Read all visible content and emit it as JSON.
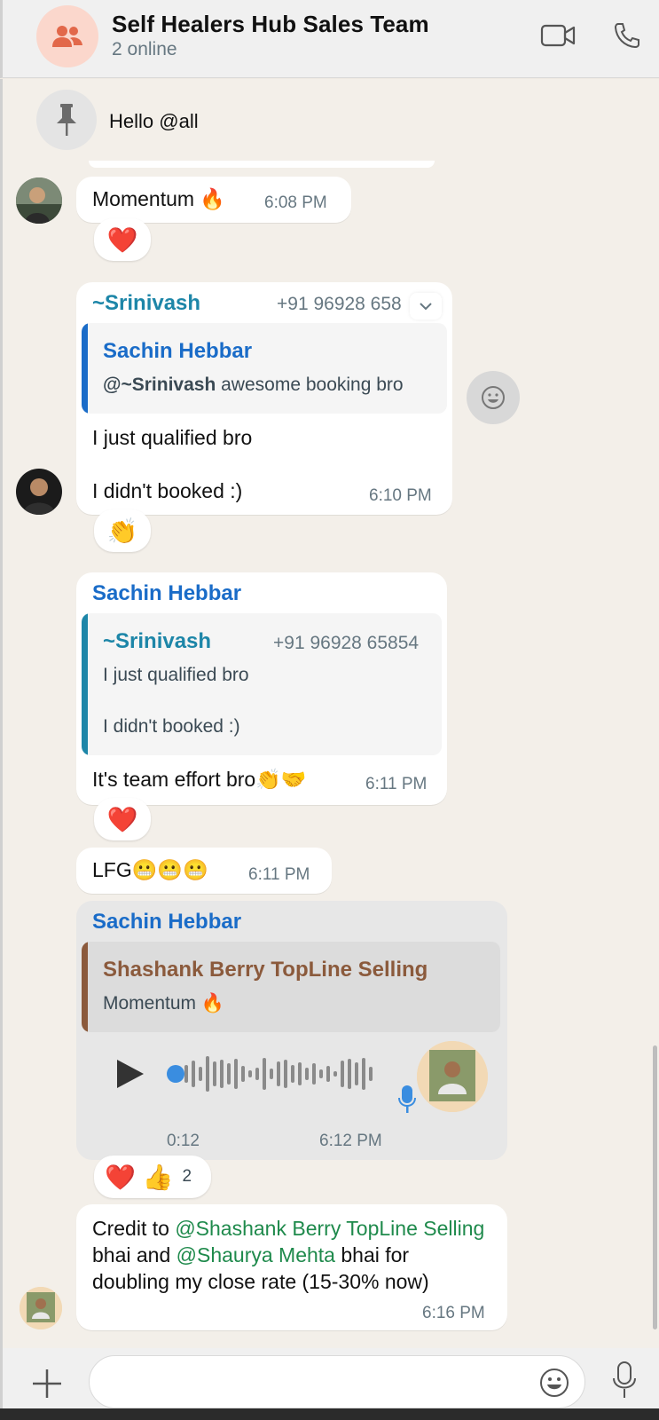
{
  "header": {
    "title": "Self Healers Hub Sales Team",
    "subtitle": "2 online",
    "video_icon": "video-camera-icon",
    "call_icon": "phone-icon"
  },
  "pinned": {
    "icon": "pin-icon",
    "text": "Hello @all"
  },
  "messages": {
    "m1": {
      "text": "Momentum 🔥",
      "time": "6:08 PM",
      "reaction": "❤️"
    },
    "m2": {
      "sender": "~Srinivash",
      "phone": "+91 96928 658",
      "quote_name": "Sachin Hebbar",
      "quote_mention": "@~Srinivash",
      "quote_rest": " awesome booking bro",
      "line1": "I just qualified bro",
      "line2": "I didn't booked :)",
      "time": "6:10 PM",
      "reaction": "👏"
    },
    "m3": {
      "sender": "Sachin Hebbar",
      "quote_name": "~Srinivash",
      "quote_phone": "+91 96928 65854",
      "quote_line1": "I just qualified bro",
      "quote_line2": "I didn't booked :)",
      "text": "It's team effort bro👏🤝",
      "time": "6:11 PM",
      "reaction": "❤️"
    },
    "m4": {
      "text": "LFG😬😬😬",
      "time": "6:11 PM"
    },
    "m5": {
      "sender": "Sachin Hebbar",
      "quote_name": "Shashank Berry TopLine Selling",
      "quote_text": "Momentum 🔥",
      "duration": "0:12",
      "time": "6:12 PM",
      "reaction_emojis": "❤️ 👍",
      "reaction_count": "2"
    },
    "m6": {
      "p1": "Credit to ",
      "mention1": "@Shashank Berry TopLine Selling",
      "p2": " bhai and ",
      "mention2": "@Shaurya Mehta",
      "p3": " bhai for doubling my close rate (15-30% now)",
      "time": "6:16 PM"
    }
  },
  "footer": {
    "attach_icon": "plus-icon",
    "emoji_icon": "emoji-icon",
    "mic_icon": "microphone-icon"
  }
}
